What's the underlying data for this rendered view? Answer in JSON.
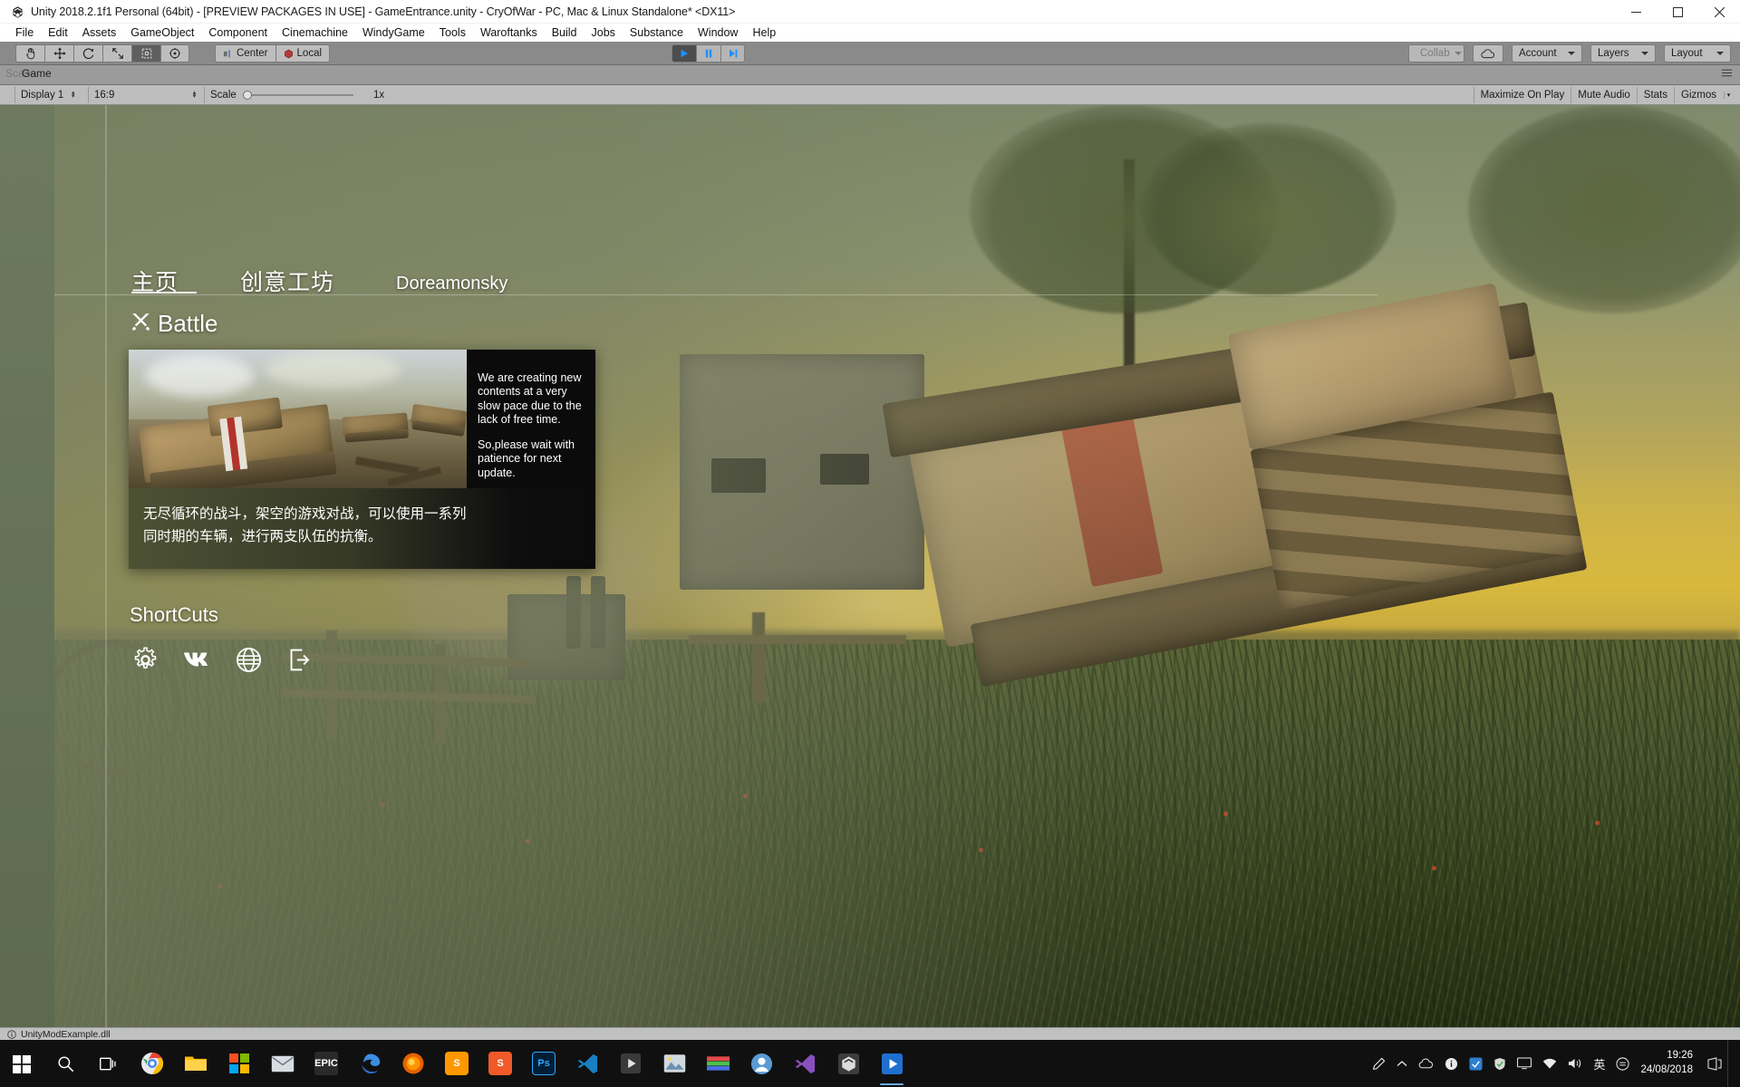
{
  "window": {
    "title": "Unity 2018.2.1f1 Personal (64bit) - [PREVIEW PACKAGES IN USE] - GameEntrance.unity - CryOfWar - PC, Mac & Linux Standalone* <DX11>",
    "logo_icon": "unity-logo-icon",
    "minimize_icon": "minimize-icon",
    "maximize_icon": "maximize-icon",
    "close_icon": "close-icon"
  },
  "menubar": {
    "items": [
      {
        "label": "File"
      },
      {
        "label": "Edit"
      },
      {
        "label": "Assets"
      },
      {
        "label": "GameObject"
      },
      {
        "label": "Component"
      },
      {
        "label": "Cinemachine"
      },
      {
        "label": "WindyGame"
      },
      {
        "label": "Tools"
      },
      {
        "label": "Waroftanks"
      },
      {
        "label": "Build"
      },
      {
        "label": "Jobs"
      },
      {
        "label": "Substance"
      },
      {
        "label": "Window"
      },
      {
        "label": "Help"
      }
    ]
  },
  "toolbar": {
    "tools": [
      {
        "name": "hand-tool",
        "icon": "hand-icon",
        "active": false
      },
      {
        "name": "move-tool",
        "icon": "move-icon",
        "active": false
      },
      {
        "name": "rotate-tool",
        "icon": "rotate-icon",
        "active": false
      },
      {
        "name": "scale-tool",
        "icon": "scale-icon",
        "active": false
      },
      {
        "name": "rect-tool",
        "icon": "rect-transform-icon",
        "active": true
      },
      {
        "name": "transform-tool",
        "icon": "transform-icon",
        "active": false
      }
    ],
    "pivot_label": "Center",
    "pivot_icon": "pivot-center-icon",
    "handle_label": "Local",
    "handle_icon": "handle-local-icon",
    "play_label": "play-icon",
    "pause_label": "pause-icon",
    "step_label": "step-icon",
    "play_engaged": true,
    "collab_label": "Collab",
    "collab_icon": "collab-check-icon",
    "cloud_icon": "cloud-icon",
    "account_label": "Account",
    "layers_label": "Layers",
    "layout_label": "Layout"
  },
  "editor_tabs": {
    "ghost_tab": "Scene",
    "active_tab": "Game",
    "menu_icon": "tab-menu-icon"
  },
  "gameview_bar": {
    "display_label": "Display 1",
    "aspect_label": "16:9",
    "scale_label": "Scale",
    "scale_value": "1x",
    "maximize_label": "Maximize On Play",
    "mute_label": "Mute Audio",
    "stats_label": "Stats",
    "gizmos_label": "Gizmos"
  },
  "game_ui": {
    "nav_tabs": [
      {
        "label": "主页",
        "active": true,
        "script": "cjk"
      },
      {
        "label": "创意工坊",
        "active": false,
        "script": "cjk"
      },
      {
        "label": "Doreamonsky",
        "active": false,
        "script": "latin"
      }
    ],
    "battle": {
      "heading": "Battle",
      "heading_icon": "crossed-swords-icon",
      "news_paragraph_1": "We are creating new contents at a very slow pace due to the lack of free time.",
      "news_paragraph_2": "So,please wait with patience for next update.",
      "description_line_1": "无尽循环的战斗，架空的游戏对战，可以使用一系列",
      "description_line_2": "同时期的车辆，进行两支队伍的抗衡。"
    },
    "shortcuts": {
      "heading": "ShortCuts",
      "items": [
        {
          "name": "settings-shortcut",
          "icon": "gear-icon"
        },
        {
          "name": "vk-shortcut",
          "icon": "vk-icon"
        },
        {
          "name": "website-shortcut",
          "icon": "globe-icon"
        },
        {
          "name": "quit-shortcut",
          "icon": "exit-icon"
        }
      ]
    }
  },
  "statusbar": {
    "info_icon": "info-icon",
    "message": "UnityModExample.dll"
  },
  "taskbar": {
    "start_icon": "windows-start-icon",
    "search_icon": "search-icon",
    "taskview_icon": "task-view-icon",
    "apps": [
      {
        "name": "chrome",
        "label": "",
        "color": "#e8eaed",
        "icon": "chrome-icon"
      },
      {
        "name": "file-explorer",
        "label": "",
        "color": "#ffb900",
        "icon": "folder-icon"
      },
      {
        "name": "microsoft-store",
        "label": "",
        "color": "#ffffff",
        "icon": "store-icon"
      },
      {
        "name": "mail",
        "label": "",
        "color": "#d8dde3",
        "icon": "mail-icon"
      },
      {
        "name": "epic-games",
        "label": "EPIC",
        "color": "#2a2a2a",
        "icon": "epic-icon"
      },
      {
        "name": "edge-dev",
        "label": "",
        "color": "#2f6fd0",
        "icon": "edge-icon"
      },
      {
        "name": "firefox",
        "label": "",
        "color": "#e66000",
        "icon": "firefox-icon"
      },
      {
        "name": "sublime-text",
        "label": "S",
        "color": "#ff9800",
        "icon": "sublime-icon"
      },
      {
        "name": "sublime-merge",
        "label": "S",
        "color": "#f05a28",
        "icon": "sublime-merge-icon"
      },
      {
        "name": "photoshop",
        "label": "Ps",
        "color": "#001e36",
        "icon": "photoshop-icon"
      },
      {
        "name": "visual-studio-code",
        "label": "",
        "color": "#1a7fc1",
        "icon": "vscode-icon"
      },
      {
        "name": "media-player",
        "label": "",
        "color": "#3a3a3a",
        "icon": "play-triangle-icon"
      },
      {
        "name": "photos",
        "label": "",
        "color": "#d0d8e0",
        "icon": "photos-icon"
      },
      {
        "name": "color-app",
        "label": "",
        "color": "#6a5acd",
        "icon": "spectrum-icon"
      },
      {
        "name": "user-app",
        "label": "",
        "color": "#5b9bd5",
        "icon": "person-icon"
      },
      {
        "name": "visual-studio",
        "label": "",
        "color": "#8a4fbd",
        "icon": "visual-studio-icon"
      },
      {
        "name": "unity-editor",
        "label": "",
        "color": "#3c3c3c",
        "icon": "unity-icon"
      },
      {
        "name": "unity-player",
        "label": "",
        "color": "#1f6fd0",
        "icon": "unity-play-icon"
      }
    ],
    "tray": {
      "pen_icon": "pen-icon",
      "chevron_icon": "chevron-up-icon",
      "onedrive_icon": "onedrive-icon",
      "info_icon": "info-badge-icon",
      "blue_icon": "network-blue-icon",
      "shield_icon": "shield-icon",
      "monitor_icon": "monitor-icon",
      "network_icon": "network-icon",
      "volume_icon": "volume-icon",
      "ime_label": "英",
      "ime_sub_icon": "ime-icon",
      "time": "19:26",
      "date": "24/08/2018",
      "notification_icon": "notification-icon"
    }
  }
}
